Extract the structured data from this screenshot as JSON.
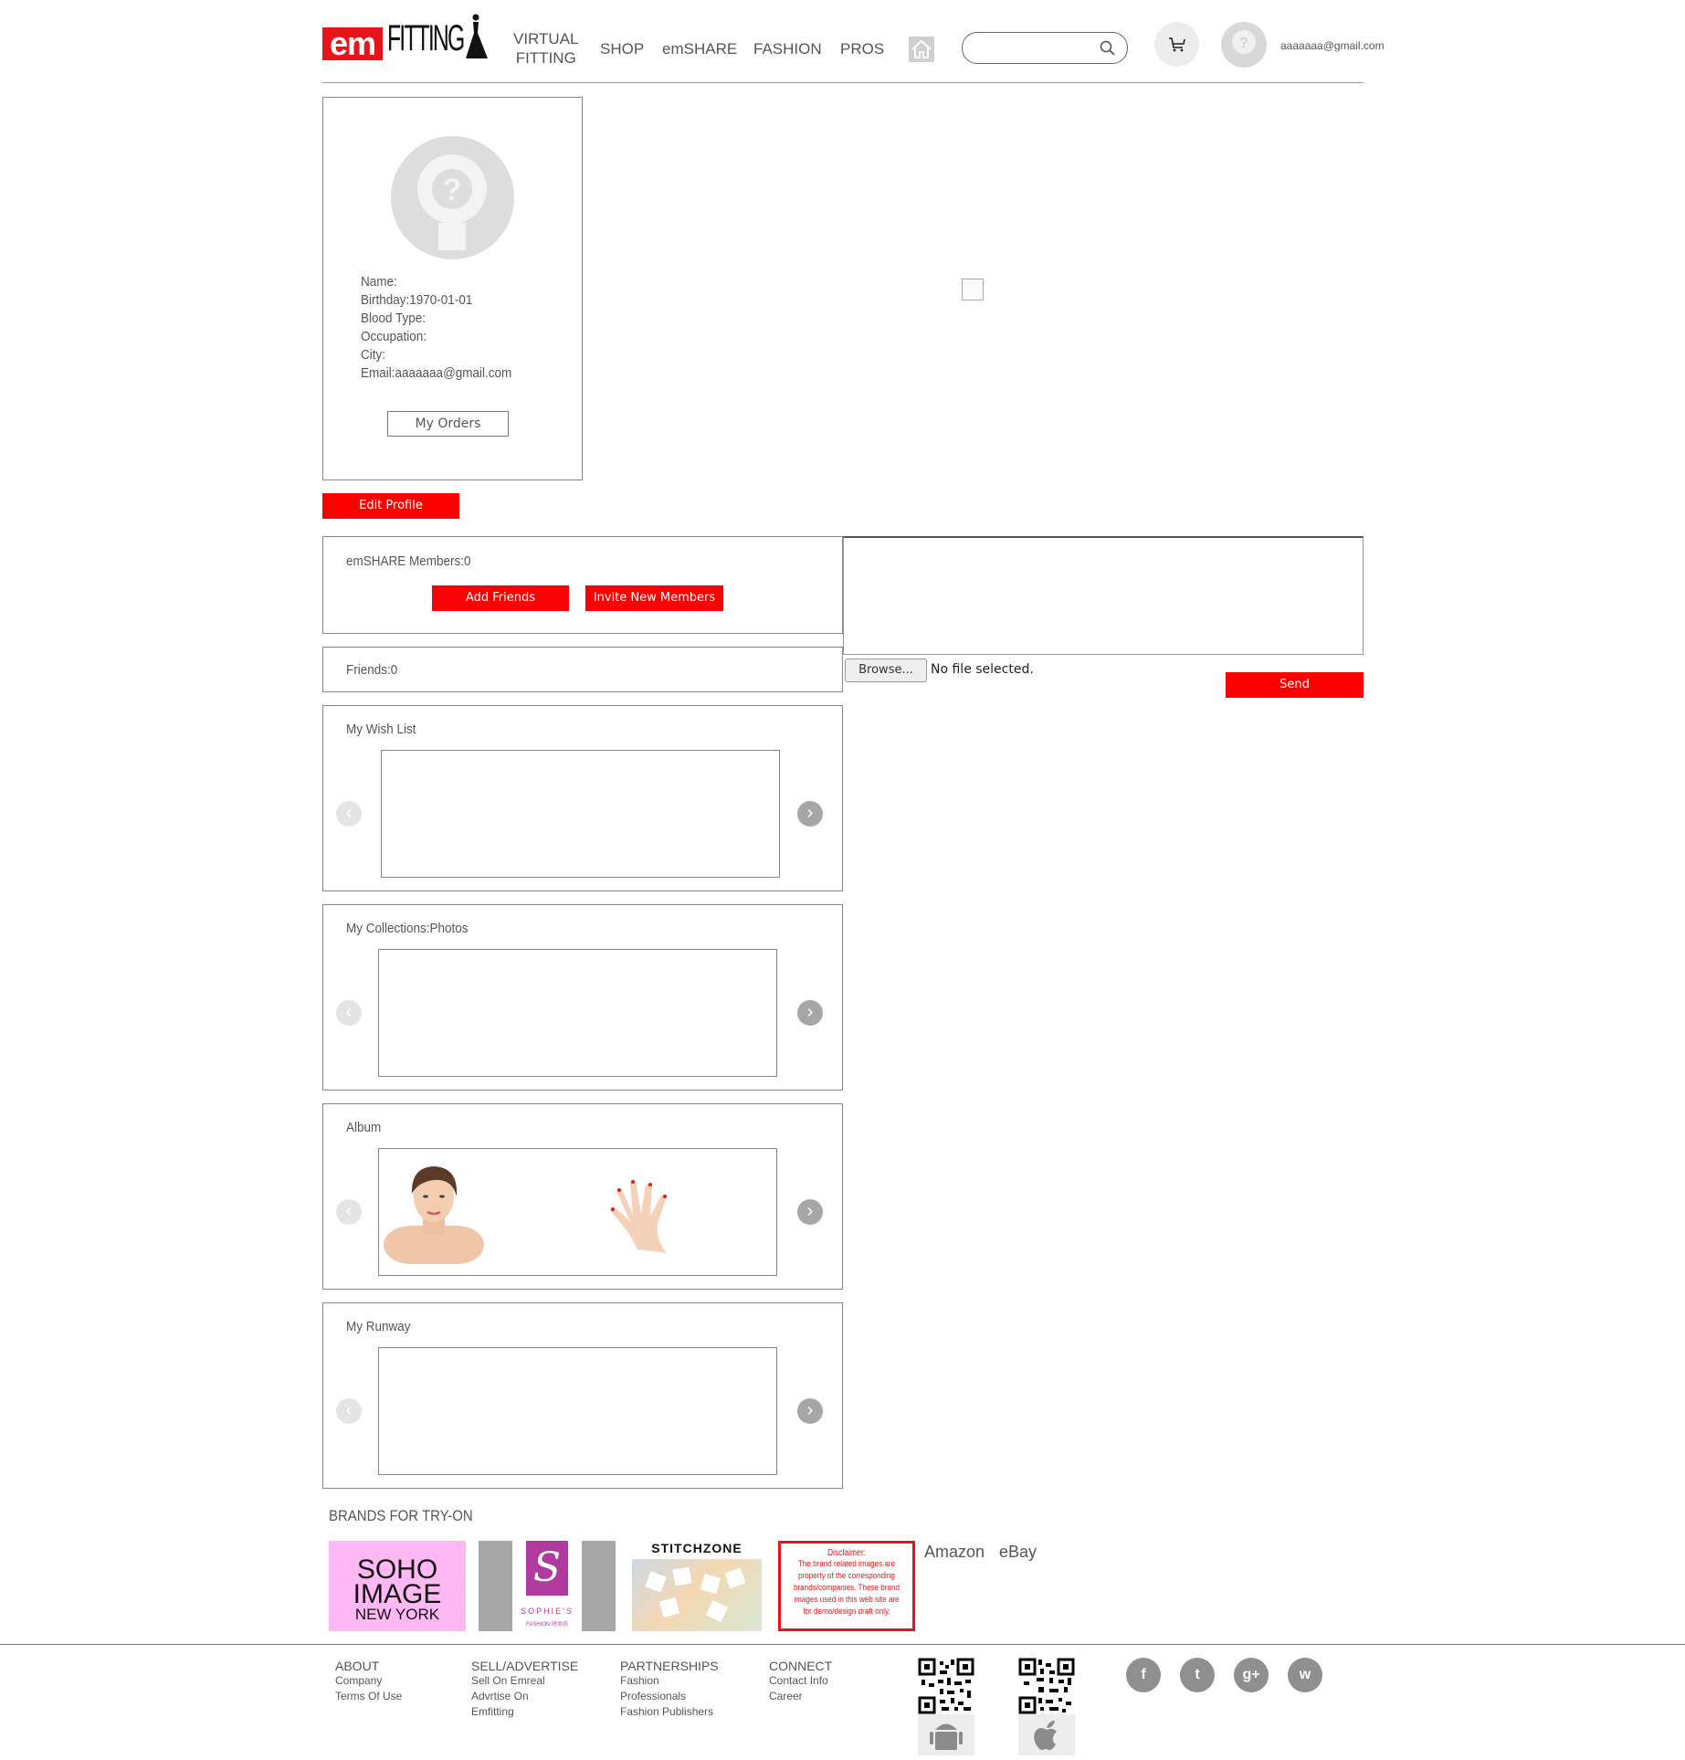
{
  "header": {
    "logo_em": "em",
    "logo_fitting": "FITTING",
    "nav": {
      "virtual_line1": "VIRTUAL",
      "virtual_line2": "FITTING",
      "shop": "SHOP",
      "emshare": "emSHARE",
      "fashion": "FASHION",
      "pros": "PROS"
    },
    "search_placeholder": "",
    "user_email": "aaaaaaa@gmail.com"
  },
  "profile": {
    "name": "Name:",
    "birthday": "Birthday:1970-01-01",
    "blood_type": "Blood Type:",
    "occupation": "Occupation:",
    "city": "City:",
    "email": "Email:aaaaaaa@gmail.com",
    "my_orders": "My Orders",
    "edit_profile": "Edit Profile"
  },
  "emshare": {
    "members": "emSHARE Members:0",
    "add_friends": "Add Friends",
    "invite": "Invite New Members",
    "friends": "Friends:0"
  },
  "post": {
    "browse": "Browse...",
    "file_status": "No file selected.",
    "send": "Send"
  },
  "sections": {
    "wish_list": "My Wish List",
    "collections": "My Collections:Photos",
    "album": "Album",
    "runway": "My Runway"
  },
  "brands": {
    "title": "BRANDS FOR TRY-ON",
    "soho_line1": "SOHO",
    "soho_line2": "IMAGE",
    "soho_line3": "NEW YORK",
    "sophies": "SOPHIE'S",
    "sophies_sub": "FASHION 时尚坊",
    "stitchzone": "STITCHZONE",
    "disclaimer_title": "Disclaimer:",
    "disclaimer_body": "The brand related images are property of the corresponding brands/companies. These brand images used in this web site are for demo/design draft only.",
    "amazon": "Amazon",
    "ebay": "eBay"
  },
  "footer": {
    "about": {
      "title": "ABOUT",
      "links": [
        "Company",
        "Terms Of Use"
      ]
    },
    "sell": {
      "title": "SELL/ADVERTISE",
      "links": [
        "Sell On Emreal",
        "Advrtise On",
        "Emfitting"
      ]
    },
    "partnerships": {
      "title": "PARTNERSHIPS",
      "links": [
        "Fashion",
        "Professionals",
        "Fashion Publishers"
      ]
    },
    "connect": {
      "title": "CONNECT",
      "links": [
        "Contact Info",
        "Career"
      ]
    },
    "social": [
      "f",
      "t",
      "g+",
      "w"
    ]
  },
  "colors": {
    "accent": "#fd0000",
    "border": "#888888"
  }
}
